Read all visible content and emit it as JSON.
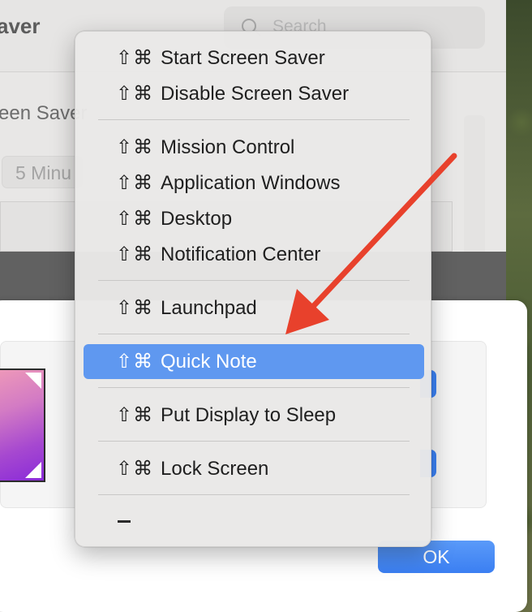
{
  "background_window": {
    "title": "aver",
    "search_placeholder": "Search",
    "setting_label": "een Saver",
    "minutes_value": "5 Minu"
  },
  "menu": {
    "items": [
      {
        "shortcut": "⇧⌘",
        "label": "Start Screen Saver",
        "selected": false
      },
      {
        "shortcut": "⇧⌘",
        "label": "Disable Screen Saver",
        "selected": false
      },
      {
        "shortcut": "⇧⌘",
        "label": "Mission Control",
        "selected": false
      },
      {
        "shortcut": "⇧⌘",
        "label": "Application Windows",
        "selected": false
      },
      {
        "shortcut": "⇧⌘",
        "label": "Desktop",
        "selected": false
      },
      {
        "shortcut": "⇧⌘",
        "label": "Notification Center",
        "selected": false
      },
      {
        "shortcut": "⇧⌘",
        "label": "Launchpad",
        "selected": false
      },
      {
        "shortcut": "⇧⌘",
        "label": "Quick Note",
        "selected": true
      },
      {
        "shortcut": "⇧⌘",
        "label": "Put Display to Sleep",
        "selected": false
      },
      {
        "shortcut": "⇧⌘",
        "label": "Lock Screen",
        "selected": false
      }
    ],
    "none_option": "–"
  },
  "dialog": {
    "ok_label": "OK"
  },
  "colors": {
    "selection": "#5f98f0",
    "accent_blue": "#3b82f6",
    "annotation_red": "#e8412c"
  },
  "icons": {
    "shortcut_modifiers": "shift-command-icon",
    "annotation": "red-arrow-icon",
    "search": "search-icon"
  }
}
